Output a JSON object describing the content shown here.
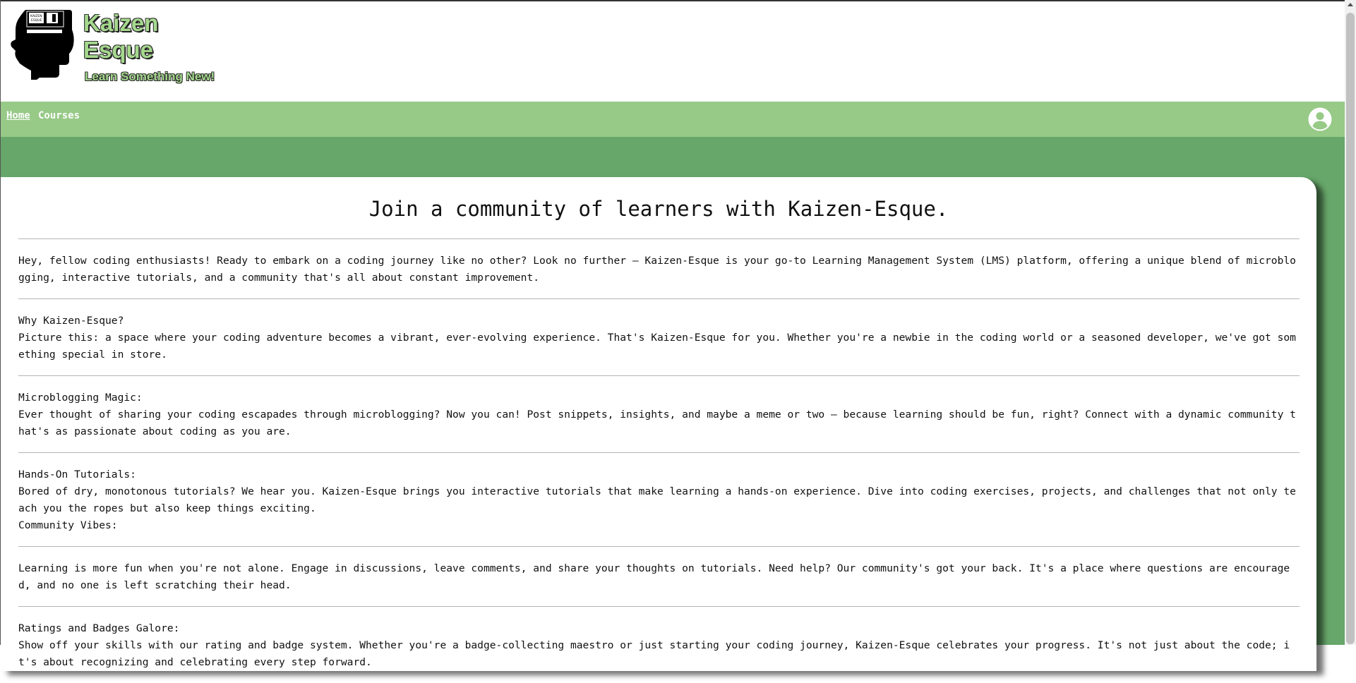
{
  "brand": {
    "name_line1": "Kaizen",
    "name_line2": "Esque",
    "tagline": "Learn Something New!",
    "logo_text_line1": "KAIZEN",
    "logo_text_line2": "ESQUE"
  },
  "nav": {
    "home_label": "Home",
    "courses_label": "Courses"
  },
  "main": {
    "title": "Join a community of learners with Kaizen-Esque.",
    "intro": "Hey, fellow coding enthusiasts! Ready to embark on a coding journey like no other? Look no further – Kaizen-Esque is your go-to Learning Management System (LMS) platform, offering a unique blend of microblogging, interactive tutorials, and a community that's all about constant improvement.",
    "why_heading": "Why Kaizen-Esque?",
    "why_text": "Picture this: a space where your coding adventure becomes a vibrant, ever-evolving experience. That's Kaizen-Esque for you. Whether you're a newbie in the coding world or a seasoned developer, we've got something special in store.",
    "micro_heading": "Microblogging Magic:",
    "micro_text": "Ever thought of sharing your coding escapades through microblogging? Now you can! Post snippets, insights, and maybe a meme or two – because learning should be fun, right? Connect with a dynamic community that's as passionate about coding as you are.",
    "hands_heading": "Hands-On Tutorials:",
    "hands_text": "Bored of dry, monotonous tutorials? We hear you. Kaizen-Esque brings you interactive tutorials that make learning a hands-on experience. Dive into coding exercises, projects, and challenges that not only teach you the ropes but also keep things exciting.",
    "community_heading": "Community Vibes:",
    "community_text": "Learning is more fun when you're not alone. Engage in discussions, leave comments, and share your thoughts on tutorials. Need help? Our community's got your back. It's a place where questions are encouraged, and no one is left scratching their head.",
    "ratings_heading": "Ratings and Badges Galore:",
    "ratings_text": "Show off your skills with our rating and badge system. Whether you're a badge-collecting maestro or just starting your coding journey, Kaizen-Esque celebrates your progress. It's not just about the code; it's about recognizing and celebrating every step forward."
  },
  "colors": {
    "nav_bg": "#97c987",
    "band_bg": "#67a76a",
    "brand_text": "#a6d98e"
  },
  "icons": {
    "logo": "head-silhouette-with-floppy-disk",
    "account": "user-circle-icon"
  }
}
